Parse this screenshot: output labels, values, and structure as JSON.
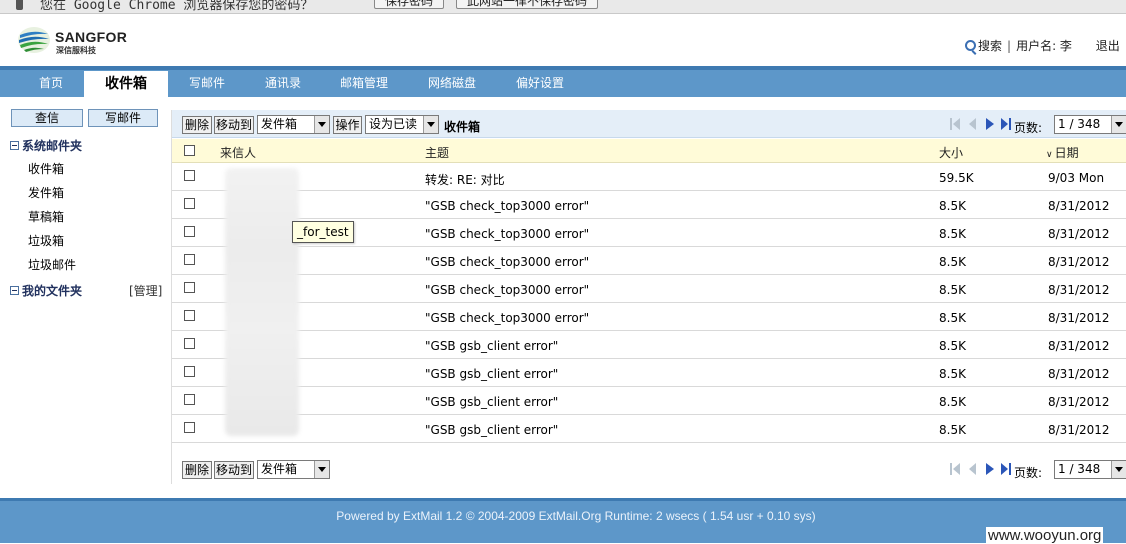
{
  "infobar": {
    "message": "您在 Google Chrome 浏览器保存您的密码？",
    "save_btn": "保存密码",
    "never_btn": "此网站一律不保存密码"
  },
  "header": {
    "logo_name": "SANGFOR",
    "logo_sub": "深信服科技",
    "search_label": "搜索",
    "user_label": "用户名: 李",
    "logout_label": "退出"
  },
  "nav": {
    "tabs": [
      {
        "label": "首页"
      },
      {
        "label": "收件箱"
      },
      {
        "label": "写邮件"
      },
      {
        "label": "通讯录"
      },
      {
        "label": "邮箱管理"
      },
      {
        "label": "网络磁盘"
      },
      {
        "label": "偏好设置"
      }
    ]
  },
  "sidebar": {
    "check_mail_btn": "查信",
    "compose_btn": "写邮件",
    "system_folders_title": "系统邮件夹",
    "system_folders": [
      "收件箱",
      "发件箱",
      "草稿箱",
      "垃圾箱",
      "垃圾邮件"
    ],
    "my_folders_title": "我的文件夹",
    "manage_label": "[管理]"
  },
  "toolbar": {
    "delete_btn": "删除",
    "move_to_btn": "移动到",
    "move_target": "发件箱",
    "action_btn": "操作",
    "mark_select": "设为已读",
    "folder_name": "收件箱",
    "page_label": "页数:",
    "page_value": "1 / 348"
  },
  "table": {
    "col_from": "来信人",
    "col_subject": "主题",
    "col_size": "大小",
    "col_date": "日期",
    "rows": [
      {
        "subject": "转发: RE: 对比",
        "size": "59.5K",
        "date": "9/03 Mon"
      },
      {
        "subject": "\"GSB check_top3000 error\"",
        "size": "8.5K",
        "date": "8/31/2012"
      },
      {
        "subject": "\"GSB check_top3000 error\"",
        "size": "8.5K",
        "date": "8/31/2012"
      },
      {
        "subject": "\"GSB check_top3000 error\"",
        "size": "8.5K",
        "date": "8/31/2012"
      },
      {
        "subject": "\"GSB check_top3000 error\"",
        "size": "8.5K",
        "date": "8/31/2012"
      },
      {
        "subject": "\"GSB check_top3000 error\"",
        "size": "8.5K",
        "date": "8/31/2012"
      },
      {
        "subject": "\"GSB gsb_client error\"",
        "size": "8.5K",
        "date": "8/31/2012"
      },
      {
        "subject": "\"GSB gsb_client error\"",
        "size": "8.5K",
        "date": "8/31/2012"
      },
      {
        "subject": "\"GSB gsb_client error\"",
        "size": "8.5K",
        "date": "8/31/2012"
      },
      {
        "subject": "\"GSB gsb_client error\"",
        "size": "8.5K",
        "date": "8/31/2012"
      }
    ],
    "tooltip": "_for_test"
  },
  "footer": {
    "powered_by": "Powered by ExtMail 1.2 © 2004-2009 ExtMail.Org Runtime: 2 wsecs ( 1.54 usr + 0.10 sys)",
    "watermark": "www.wooyun.org"
  },
  "colors": {
    "nav_bar": "#5d97c9",
    "toolbar_bg": "#e4eef8",
    "table_header_bg": "#fffbd8"
  }
}
